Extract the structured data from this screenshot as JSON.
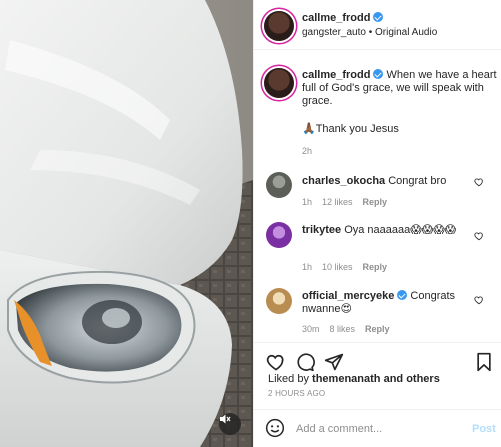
{
  "header": {
    "username": "callme_frodd",
    "audio": "gangster_auto • Original Audio"
  },
  "caption": {
    "username": "callme_frodd",
    "text": "When we have a heart full of God's grace, we will speak with grace.",
    "line2": "🙏🏾Thank you Jesus",
    "time": "2h"
  },
  "comments": [
    {
      "username": "charles_okocha",
      "text": "Congrat bro",
      "time": "1h",
      "likes": "12 likes",
      "reply": "Reply",
      "avatar_color": "#6b6f68"
    },
    {
      "username": "trikytee",
      "text": "Oya naaaaaa😱😱😱😱",
      "time": "1h",
      "likes": "10 likes",
      "reply": "Reply",
      "avatar_color": "#8a3bb0"
    },
    {
      "username": "official_mercyeke",
      "text": "Congrats nwanne😍",
      "time": "30m",
      "likes": "8 likes",
      "reply": "Reply",
      "avatar_color": "#d6b07a"
    }
  ],
  "actions": {
    "liked_by_prefix": "Liked by",
    "liked_by_user": "themenanath",
    "liked_by_suffix": "and others",
    "time_ago": "2 HOURS AGO"
  },
  "comment_box": {
    "placeholder": "Add a comment...",
    "post_label": "Post"
  },
  "icons": {
    "like": "heart-icon",
    "comment": "comment-icon",
    "share": "share-icon",
    "save": "bookmark-icon",
    "emoji": "emoji-icon",
    "mute": "muted-speaker-icon"
  },
  "colors": {
    "verified": "#3897f0",
    "post_button": "#b2dffc",
    "muted_text": "#8e8e8e"
  }
}
